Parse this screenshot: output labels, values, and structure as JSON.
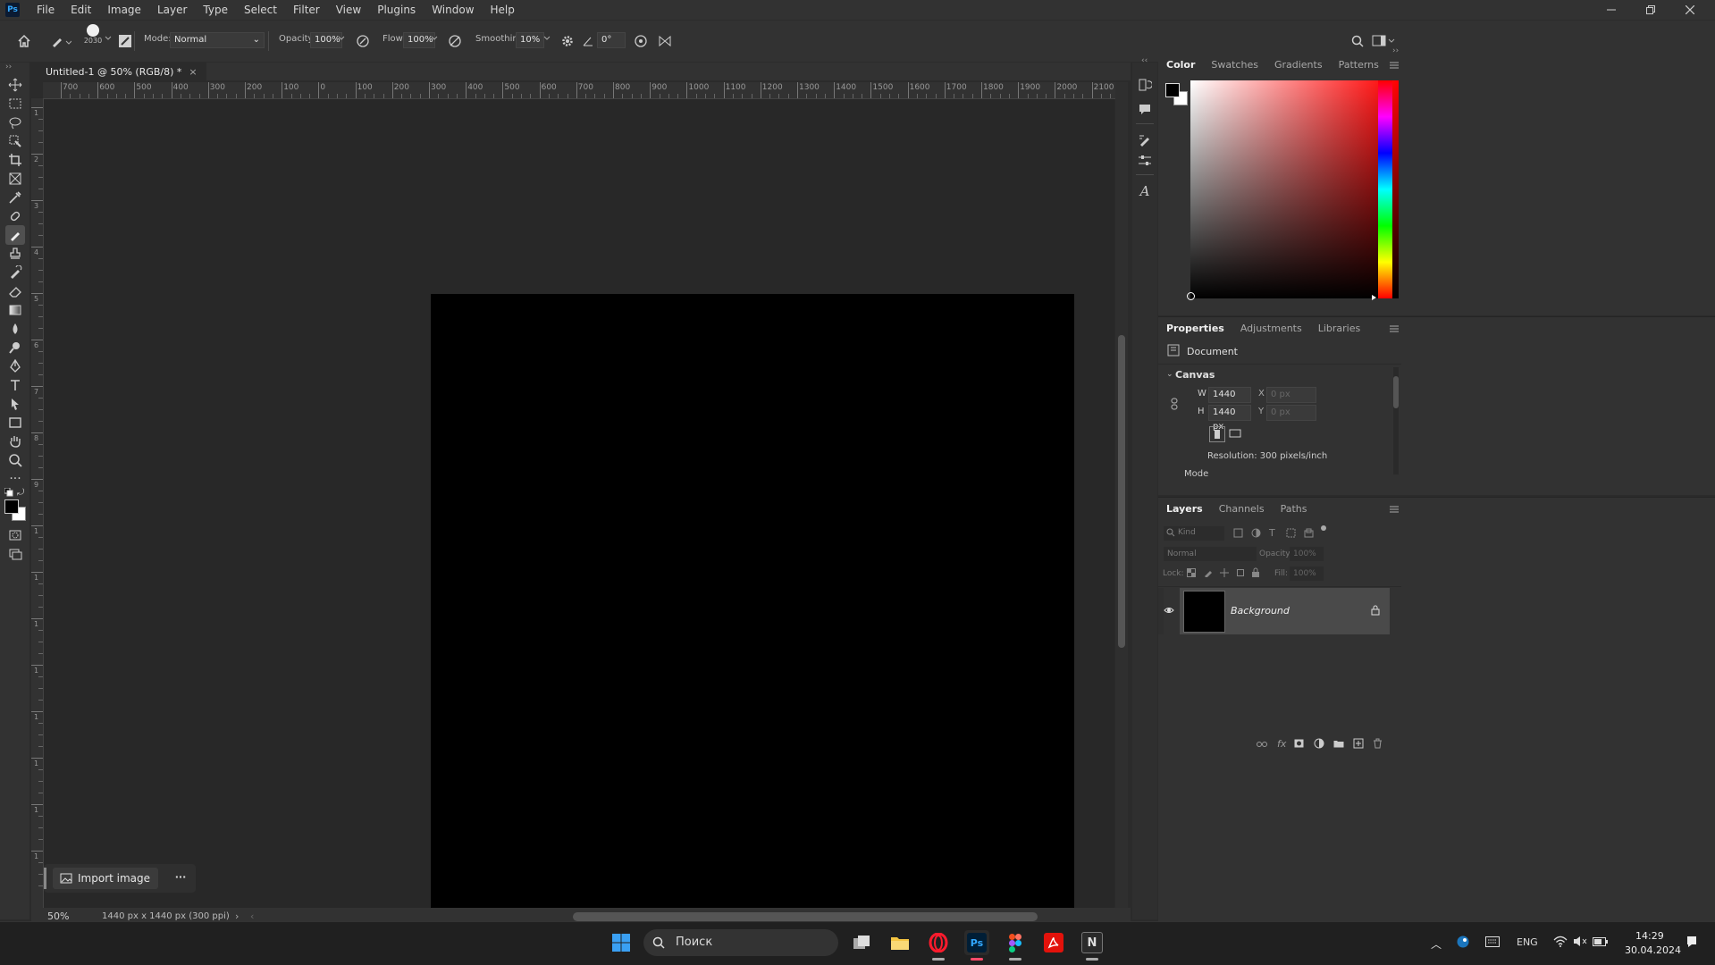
{
  "app": {
    "logo": "Ps",
    "menu": [
      "File",
      "Edit",
      "Image",
      "Layer",
      "Type",
      "Select",
      "Filter",
      "View",
      "Plugins",
      "Window",
      "Help"
    ]
  },
  "options_bar": {
    "brush_size": "2030",
    "mode_label": "Mode:",
    "mode_value": "Normal",
    "opacity_label": "Opacity:",
    "opacity_value": "100%",
    "flow_label": "Flow:",
    "flow_value": "100%",
    "smoothing_label": "Smoothing:",
    "smoothing_value": "10%",
    "angle_value": "0°"
  },
  "document": {
    "tab_title": "Untitled-1 @ 50% (RGB/8) *",
    "canvas_color": "#000000",
    "ruler_labels_h": [
      "700",
      "600",
      "500",
      "400",
      "300",
      "200",
      "100",
      "0",
      "100",
      "200",
      "300",
      "400",
      "500",
      "600",
      "700",
      "800",
      "900",
      "1000",
      "1100",
      "1200",
      "1300",
      "1400",
      "1500",
      "1600",
      "1700",
      "1800",
      "1900",
      "2000",
      "2100"
    ],
    "ruler_labels_v": [
      "1",
      "2",
      "3",
      "4",
      "5",
      "6",
      "7",
      "8",
      "9",
      "1",
      "1",
      "1",
      "1",
      "1",
      "1",
      "1",
      "1"
    ]
  },
  "import_button": {
    "label": "Import image",
    "more": "···"
  },
  "status_bar": {
    "zoom": "50%",
    "doc_info": "1440 px x 1440 px (300 ppi)"
  },
  "color_panel": {
    "tabs": [
      "Color",
      "Swatches",
      "Gradients",
      "Patterns"
    ],
    "foreground": "#000000",
    "background": "#ffffff",
    "hue_color": "#ff0000"
  },
  "properties_panel": {
    "tabs": [
      "Properties",
      "Adjustments",
      "Libraries"
    ],
    "type_label": "Document",
    "section": "Canvas",
    "w_label": "W",
    "w_value": "1440 px",
    "h_label": "H",
    "h_value": "1440 px",
    "x_label": "X",
    "x_value": "0 px",
    "y_label": "Y",
    "y_value": "0 px",
    "resolution": "Resolution: 300 pixels/inch",
    "mode_label": "Mode"
  },
  "layers_panel": {
    "tabs": [
      "Layers",
      "Channels",
      "Paths"
    ],
    "filter_placeholder": "Kind",
    "blend_mode": "Normal",
    "opacity_label": "Opacity:",
    "opacity_value": "100%",
    "lock_label": "Lock:",
    "fill_label": "Fill:",
    "fill_value": "100%",
    "layers": [
      {
        "name": "Background",
        "visible": true,
        "locked": true
      }
    ]
  },
  "taskbar": {
    "search_placeholder": "Поиск",
    "language": "ENG",
    "time": "14:29",
    "date": "30.04.2024"
  }
}
